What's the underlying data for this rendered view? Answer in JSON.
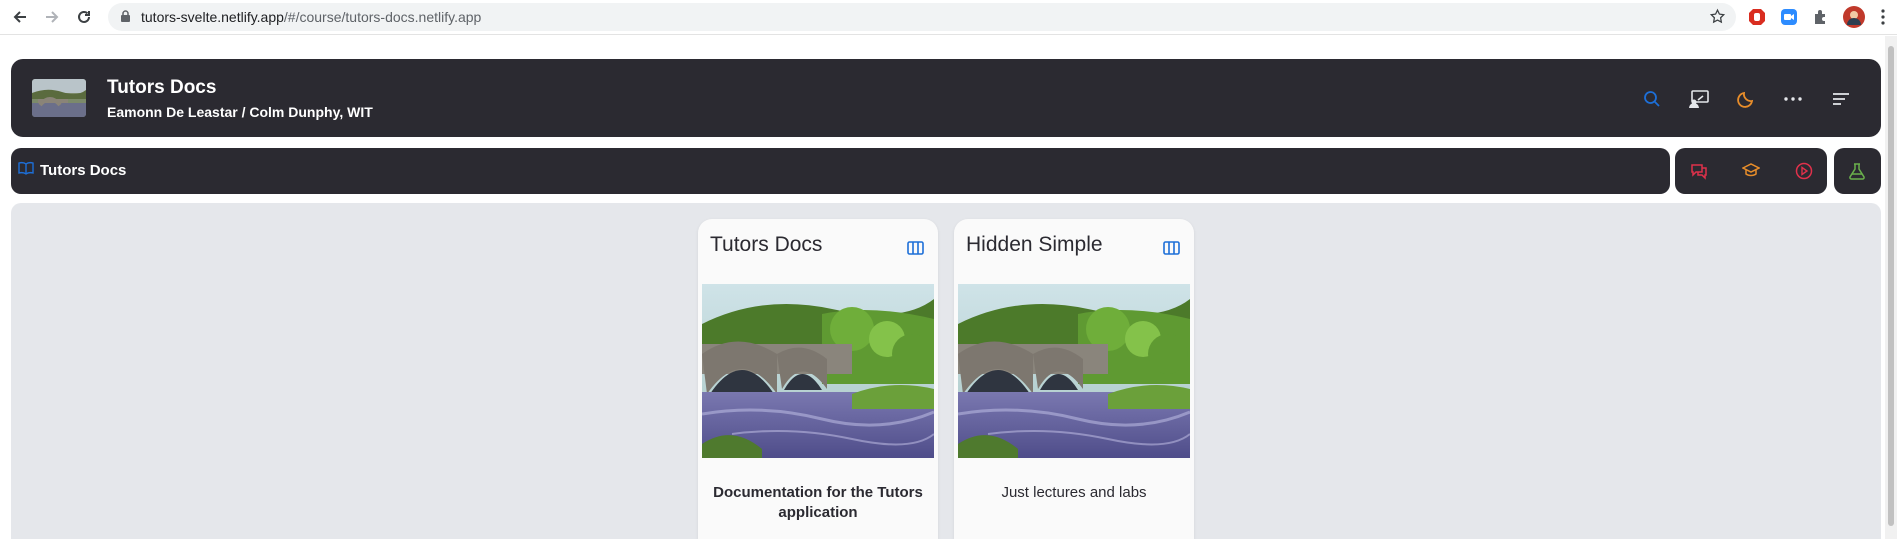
{
  "browser": {
    "url_host": "tutors-svelte.netlify.app",
    "url_path": "/#/course/tutors-docs.netlify.app",
    "icons": [
      "back-icon",
      "forward-icon",
      "reload-icon",
      "lock-icon",
      "star-icon",
      "adblock-extension-icon",
      "zoom-extension-icon",
      "puzzle-extension-icon",
      "profile-avatar",
      "kebab-menu-icon"
    ]
  },
  "header": {
    "title": "Tutors Docs",
    "subtitle": "Eamonn De Leastar / Colm Dunphy, WIT",
    "icons": [
      "search-icon",
      "presentation-icon",
      "dark-mode-moon-icon",
      "more-icon",
      "menu-icon"
    ]
  },
  "breadcrumb": {
    "label": "Tutors Docs",
    "icon": "book-icon"
  },
  "toolbar": {
    "icons": [
      "chat-icon",
      "graduation-cap-icon",
      "video-play-icon",
      "flask-icon"
    ]
  },
  "cards": [
    {
      "title": "Tutors Docs",
      "description": "Documentation for the Tutors application",
      "bold": true,
      "icon": "columns-icon"
    },
    {
      "title": "Hidden Simple",
      "description": "Just lectures and labs",
      "bold": false,
      "icon": "columns-icon"
    }
  ],
  "colors": {
    "bar_bg": "#2b2a31",
    "main_bg": "#e5e7eb",
    "accent_blue": "#1d6fd8",
    "orange": "#e88d2a",
    "red": "#e0314b",
    "green": "#6ab04c"
  }
}
